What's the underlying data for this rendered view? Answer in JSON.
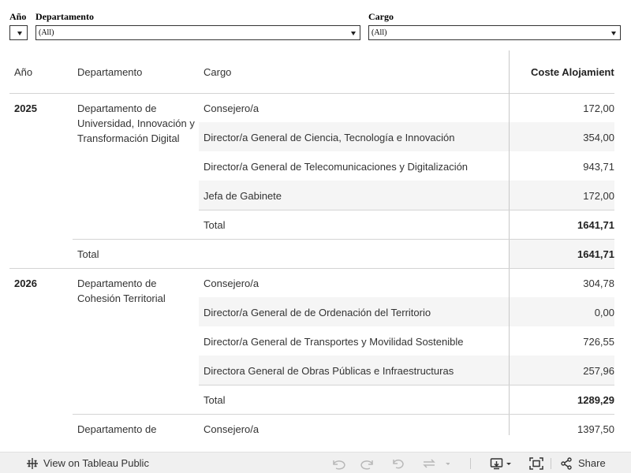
{
  "filters": {
    "year": {
      "label": "Año",
      "value": ""
    },
    "department": {
      "label": "Departamento",
      "value": "(All)"
    },
    "cargo": {
      "label": "Cargo",
      "value": "(All)"
    }
  },
  "table": {
    "headers": {
      "year": "Año",
      "department": "Departamento",
      "cargo": "Cargo",
      "cost": "Coste Alojamiento"
    },
    "rows": [
      {
        "year": "2025",
        "department": "Departamento de Universidad, Innovación y Transformación Digital",
        "cargo": "Consejero/a",
        "cost": "172,00"
      },
      {
        "cargo": "Director/a General de Ciencia, Tecnología e Innovación",
        "cost": "354,00"
      },
      {
        "cargo": "Director/a General de Telecomunicaciones y Digitalización",
        "cost": "943,71"
      },
      {
        "cargo": "Jefa de Gabinete",
        "cost": "172,00"
      },
      {
        "cargo": "Total",
        "cost": "1641,71"
      },
      {
        "department": "Total",
        "cost": "1641,71"
      },
      {
        "year": "2026",
        "department": "Departamento de Cohesión Territorial",
        "cargo": "Consejero/a",
        "cost": "304,78"
      },
      {
        "cargo": "Director/a General de de Ordenación del Territorio",
        "cost": "0,00"
      },
      {
        "cargo": "Director/a General de Transportes y Movilidad Sostenible",
        "cost": "726,55"
      },
      {
        "cargo": "Directora General de Obras Públicas e Infraestructuras",
        "cost": "257,96"
      },
      {
        "cargo": "Total",
        "cost": "1289,29"
      },
      {
        "department": "Departamento de",
        "cargo": "Consejero/a",
        "cost": "1397,50"
      }
    ]
  },
  "toolbar": {
    "view_on_public": "View on Tableau Public",
    "share": "Share"
  },
  "icons": {
    "tableau_logo": "tableau-logo-icon",
    "undo": "undo-icon",
    "redo": "redo-icon",
    "revert": "revert-icon",
    "refresh": "refresh-icon",
    "download": "download-icon",
    "fullscreen": "fullscreen-icon",
    "share": "share-icon"
  }
}
